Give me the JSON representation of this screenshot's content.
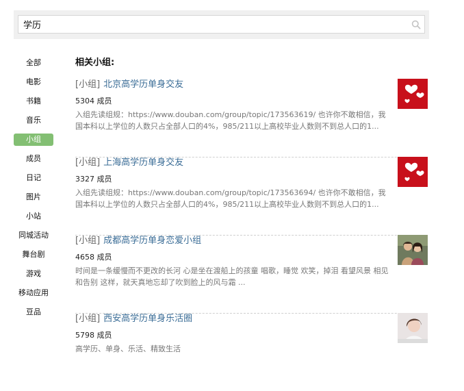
{
  "search": {
    "value": "学历"
  },
  "sidebar": {
    "items": [
      {
        "label": "全部",
        "active": false
      },
      {
        "label": "电影",
        "active": false
      },
      {
        "label": "书籍",
        "active": false
      },
      {
        "label": "音乐",
        "active": false
      },
      {
        "label": "小组",
        "active": true
      },
      {
        "label": "成员",
        "active": false
      },
      {
        "label": "日记",
        "active": false
      },
      {
        "label": "图片",
        "active": false
      },
      {
        "label": "小站",
        "active": false
      },
      {
        "label": "同城活动",
        "active": false
      },
      {
        "label": "舞台剧",
        "active": false
      },
      {
        "label": "游戏",
        "active": false
      },
      {
        "label": "移动应用",
        "active": false
      },
      {
        "label": "豆品",
        "active": false
      }
    ]
  },
  "main": {
    "section_title": "相关小组:",
    "results": [
      {
        "type": "[小组]",
        "name": "北京高学历单身交友",
        "members": "5304 成员",
        "description": "入组先读组规：https://www.douban.com/group/topic/173563619/ 也许你不敢相信，我国本科以上学位的人数只占全部人口的4%，985/211以上高校毕业人数则不到总人口的1...",
        "thumb": "hearts-image"
      },
      {
        "type": "[小组]",
        "name": "上海高学历单身交友",
        "members": "3327 成员",
        "description": "入组先读组规：https://www.douban.com/group/topic/173563694/ 也许你不敢相信，我国本科以上学位的人数只占全部人口的4%，985/211以上高校毕业人数则不到总人口的1...",
        "thumb": "hearts-image"
      },
      {
        "type": "[小组]",
        "name": "成都高学历单身恋爱小组",
        "members": "4658 成员",
        "description": "时间是一条缓慢而不更改的长河 心是坐在渡船上的孩童 唱歌，睡觉 欢笑，掉泪 看望风景 相见和告别 这样，就天真地忘却了吹到脸上的风与霜 ...",
        "thumb": "couple-photo"
      },
      {
        "type": "[小组]",
        "name": "西安高学历单身乐活圈",
        "members": "5798 成员",
        "description": "高学历、单身、乐活、精致生活",
        "thumb": "portrait-photo"
      }
    ]
  },
  "colors": {
    "accent_green": "#83bf73",
    "link_blue": "#3a6c96",
    "heart_red": "#c8101b"
  }
}
